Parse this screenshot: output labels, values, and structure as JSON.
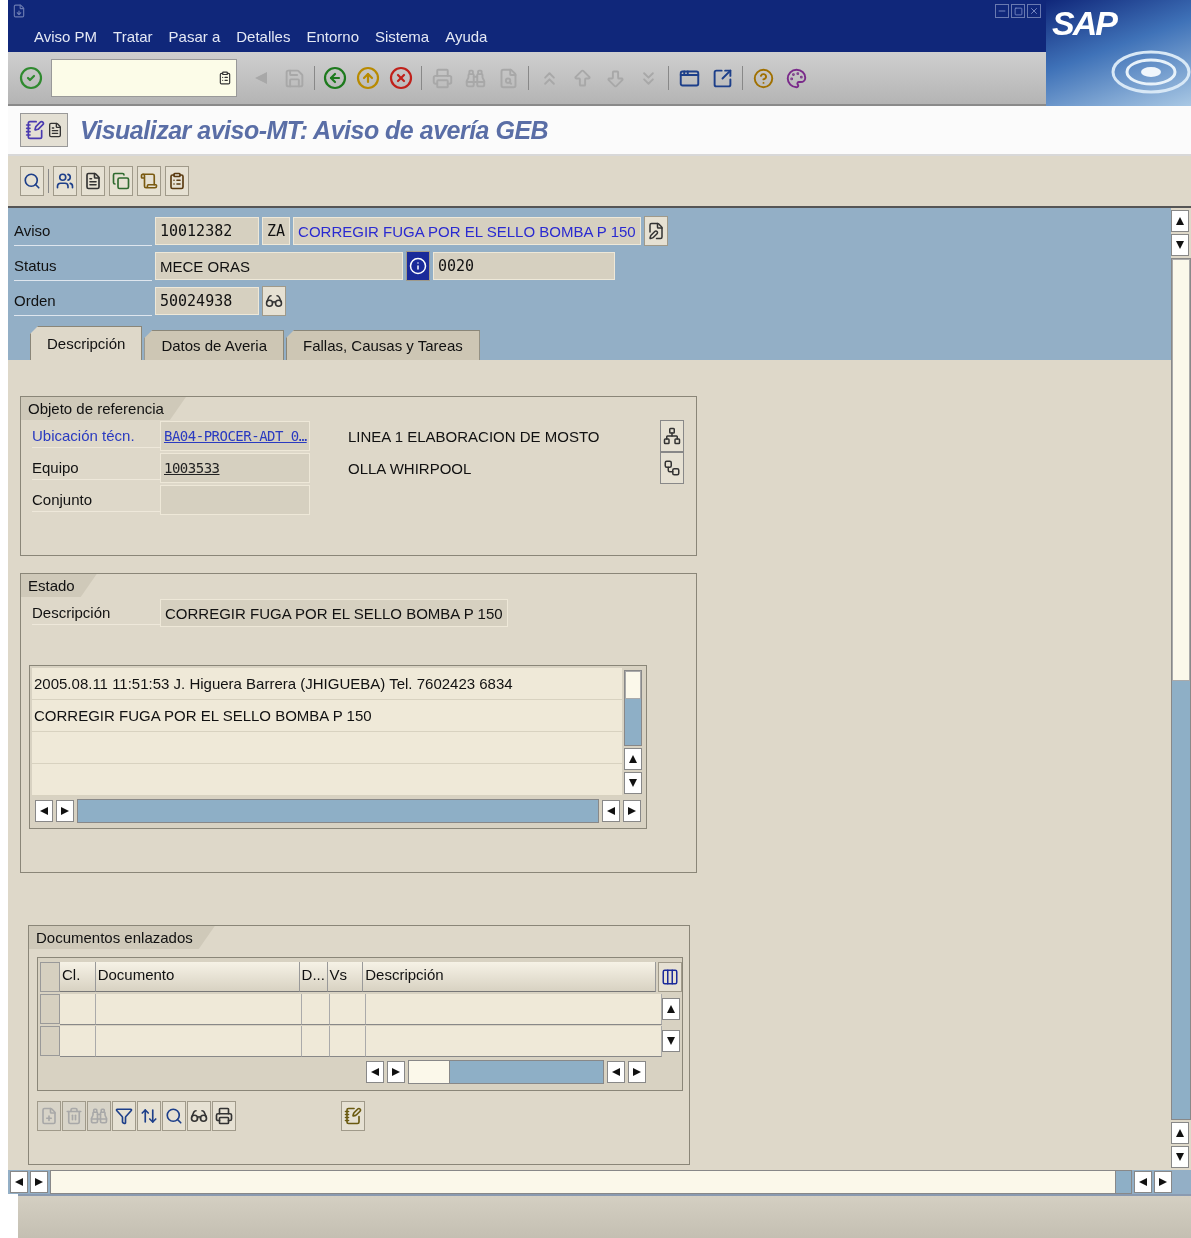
{
  "window": {
    "logo": "SAP"
  },
  "menu": [
    "Aviso PM",
    "Tratar",
    "Pasar a",
    "Detalles",
    "Entorno",
    "Sistema",
    "Ayuda"
  ],
  "standard_toolbar": [
    {
      "kind": "check",
      "disabled": false
    },
    {
      "kind": "command-field"
    },
    {
      "kind": "back-small",
      "disabled": true
    },
    {
      "kind": "save",
      "disabled": true
    },
    {
      "kind": "separator"
    },
    {
      "kind": "back",
      "disabled": false
    },
    {
      "kind": "exit",
      "disabled": false
    },
    {
      "kind": "cancel",
      "disabled": false
    },
    {
      "kind": "separator"
    },
    {
      "kind": "print",
      "disabled": true
    },
    {
      "kind": "find",
      "disabled": true
    },
    {
      "kind": "find-next",
      "disabled": true
    },
    {
      "kind": "separator"
    },
    {
      "kind": "first-page",
      "disabled": true
    },
    {
      "kind": "prev-page",
      "disabled": true
    },
    {
      "kind": "next-page",
      "disabled": true
    },
    {
      "kind": "last-page",
      "disabled": true
    },
    {
      "kind": "separator"
    },
    {
      "kind": "new-session",
      "disabled": false
    },
    {
      "kind": "shortcut",
      "disabled": false
    },
    {
      "kind": "separator"
    },
    {
      "kind": "help",
      "disabled": false
    },
    {
      "kind": "layout",
      "disabled": false
    }
  ],
  "title": "Visualizar aviso-MT: Aviso de avería GEB",
  "app_toolbar": [
    {
      "kind": "display"
    },
    {
      "kind": "separator"
    },
    {
      "kind": "partners"
    },
    {
      "kind": "text"
    },
    {
      "kind": "copy"
    },
    {
      "kind": "scroll"
    },
    {
      "kind": "clipboard"
    }
  ],
  "header": {
    "aviso": {
      "label": "Aviso",
      "number": "10012382",
      "type": "ZA",
      "description": "CORREGIR FUGA POR EL SELLO BOMBA P 150"
    },
    "status": {
      "label": "Status",
      "value": "MECE ORAS",
      "code": "0020"
    },
    "orden": {
      "label": "Orden",
      "value": "50024938"
    }
  },
  "tabs": [
    {
      "label": "Descripción",
      "selected": true
    },
    {
      "label": "Datos de Averia",
      "selected": false
    },
    {
      "label": "Fallas, Causas y Tareas",
      "selected": false
    }
  ],
  "reference_object": {
    "title": "Objeto de referencia",
    "rows": [
      {
        "label": "Ubicación técn.",
        "value": "BA04-PROCER-ADT 0…",
        "description": "LINEA 1  ELABORACION DE MOSTO",
        "link": true
      },
      {
        "label": "Equipo",
        "value": "1003533",
        "description": "OLLA WHIRPOOL",
        "link": false
      },
      {
        "label": "Conjunto",
        "link": false
      }
    ]
  },
  "estado": {
    "title": "Estado",
    "label": "Descripción",
    "value": "CORREGIR FUGA POR EL SELLO BOMBA P 150",
    "text_lines": [
      "2005.08.11 11:51:53 J. Higuera Barrera (JHIGUEBA) Tel. 7602423 6834",
      "CORREGIR FUGA POR EL SELLO BOMBA P 150"
    ]
  },
  "documents": {
    "title": "Documentos enlazados",
    "columns": [
      "Cl.",
      "Documento",
      "D...",
      "Vs",
      "Descripción"
    ],
    "toolbar": [
      {
        "kind": "create",
        "disabled": true
      },
      {
        "kind": "delete",
        "disabled": true
      },
      {
        "kind": "find",
        "disabled": true
      },
      {
        "kind": "filter",
        "disabled": false
      },
      {
        "kind": "sort",
        "disabled": false
      },
      {
        "kind": "display",
        "disabled": false
      },
      {
        "kind": "glasses",
        "disabled": false
      },
      {
        "kind": "print",
        "disabled": false
      }
    ],
    "extra_button": {
      "kind": "notes",
      "disabled": false
    }
  }
}
